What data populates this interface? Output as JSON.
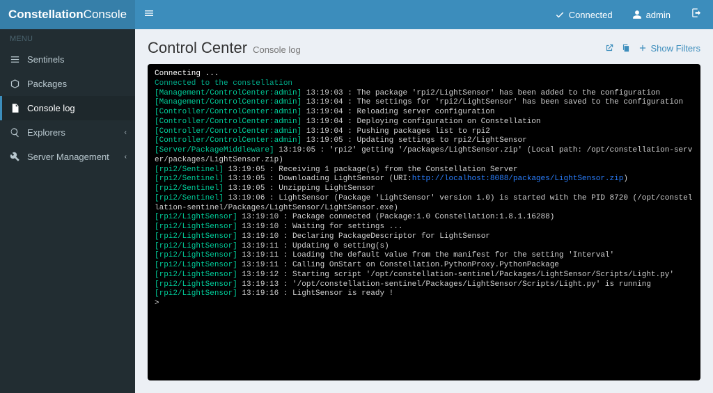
{
  "brand": {
    "bold": "Constellation",
    "light": "Console"
  },
  "header": {
    "status": "Connected",
    "user": "admin"
  },
  "sidebar": {
    "header": "MENU",
    "items": [
      {
        "label": "Sentinels"
      },
      {
        "label": "Packages"
      },
      {
        "label": "Console log"
      },
      {
        "label": "Explorers"
      },
      {
        "label": "Server Management"
      }
    ]
  },
  "page": {
    "title": "Control Center",
    "subtitle": "Console log",
    "show_filters": "Show Filters"
  },
  "console": {
    "connecting": "Connecting ...",
    "connected": "Connected to the constellation",
    "lines": [
      {
        "tag": "[Management/ControlCenter:admin]",
        "ts": "13:19:03",
        "msg": "The package 'rpi2/LightSensor' has been added to the configuration"
      },
      {
        "tag": "[Management/ControlCenter:admin]",
        "ts": "13:19:04",
        "msg": "The settings for 'rpi2/LightSensor' has been saved to the configuration"
      },
      {
        "tag": "[Controller/ControlCenter:admin]",
        "ts": "13:19:04",
        "msg": "Reloading server configuration"
      },
      {
        "tag": "[Controller/ControlCenter:admin]",
        "ts": "13:19:04",
        "msg": "Deploying configuration on Constellation"
      },
      {
        "tag": "[Controller/ControlCenter:admin]",
        "ts": "13:19:04",
        "msg": "Pushing packages list to rpi2"
      },
      {
        "tag": "[Controller/ControlCenter:admin]",
        "ts": "13:19:05",
        "msg": "Updating settings to rpi2/LightSensor"
      },
      {
        "tag": "[Server/PackageMiddleware]",
        "ts": "13:19:05",
        "msg": "'rpi2' getting '/packages/LightSensor.zip' (Local path: /opt/constellation-server/packages/LightSensor.zip)"
      },
      {
        "tag": "[rpi2/Sentinel]",
        "ts": "13:19:05",
        "msg": "Receiving 1 package(s) from the Constellation Server"
      },
      {
        "tag": "[rpi2/Sentinel]",
        "ts": "13:19:05",
        "msg_pre": "Downloading LightSensor (URI:",
        "link": "http://localhost:8088/packages/LightSensor.zip",
        "msg_post": ")"
      },
      {
        "tag": "[rpi2/Sentinel]",
        "ts": "13:19:05",
        "msg": "Unzipping LightSensor"
      },
      {
        "tag": "[rpi2/Sentinel]",
        "ts": "13:19:06",
        "msg": "LightSensor (Package 'LightSensor' version 1.0) is started with the PID 8720 (/opt/constellation-sentinel/Packages/LightSensor/LightSensor.exe)"
      },
      {
        "tag": "[rpi2/LightSensor]",
        "ts": "13:19:10",
        "msg": "Package connected (Package:1.0 Constellation:1.8.1.16288)"
      },
      {
        "tag": "[rpi2/LightSensor]",
        "ts": "13:19:10",
        "msg": "Waiting for settings ..."
      },
      {
        "tag": "[rpi2/LightSensor]",
        "ts": "13:19:10",
        "msg": "Declaring PackageDescriptor for LightSensor"
      },
      {
        "tag": "[rpi2/LightSensor]",
        "ts": "13:19:11",
        "msg": "Updating 0 setting(s)"
      },
      {
        "tag": "[rpi2/LightSensor]",
        "ts": "13:19:11",
        "msg": "Loading the default value from the manifest for the setting 'Interval'"
      },
      {
        "tag": "[rpi2/LightSensor]",
        "ts": "13:19:11",
        "msg": "Calling OnStart on Constellation.PythonProxy.PythonPackage"
      },
      {
        "tag": "[rpi2/LightSensor]",
        "ts": "13:19:12",
        "msg": "Starting script '/opt/constellation-sentinel/Packages/LightSensor/Scripts/Light.py'"
      },
      {
        "tag": "[rpi2/LightSensor]",
        "ts": "13:19:13",
        "msg": "'/opt/constellation-sentinel/Packages/LightSensor/Scripts/Light.py' is running"
      },
      {
        "tag": "[rpi2/LightSensor]",
        "ts": "13:19:16",
        "msg": "LightSensor is ready !"
      }
    ],
    "prompt": ">"
  }
}
